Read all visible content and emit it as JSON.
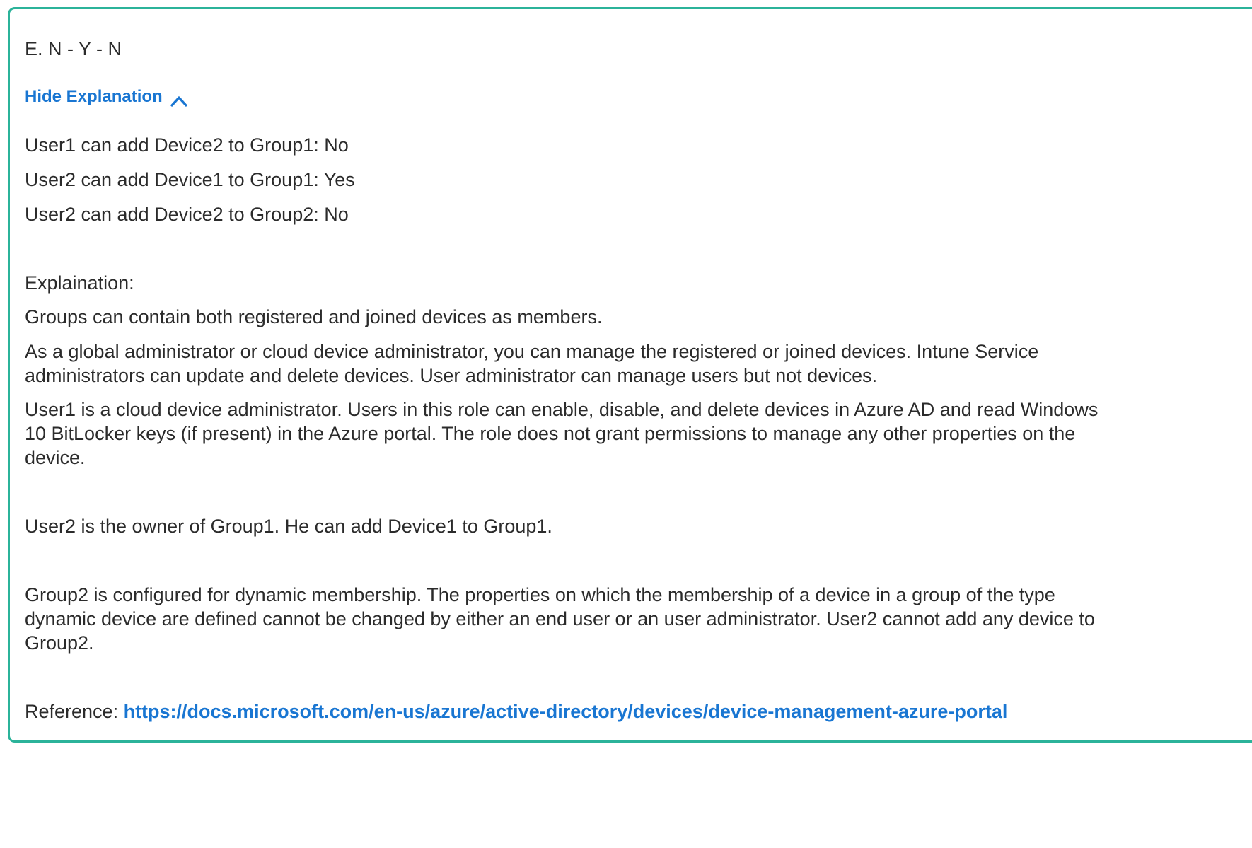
{
  "answer": "E. N - Y - N",
  "toggle": {
    "label": "Hide Explanation",
    "icon": "chevron-up-icon",
    "color": "#1976d2"
  },
  "results": [
    "User1 can add Device2 to Group1: No",
    "User2 can add Device1 to Group1: Yes",
    "User2 can add Device2 to Group2: No"
  ],
  "explanation": {
    "heading": "Explaination:",
    "paragraphs": [
      "Groups can contain both registered and joined devices as members.",
      "As a global administrator or cloud device administrator, you can manage the registered or joined devices. Intune Service administrators can update and delete devices. User administrator can manage users but not devices.",
      "User1 is a cloud device administrator. Users in this role can enable, disable, and delete devices in Azure AD and read Windows 10 BitLocker keys (if present) in the Azure portal. The role does not grant permissions to manage any other properties on the device.",
      "User2 is the owner of Group1. He can add Device1 to Group1.",
      "Group2 is configured for dynamic membership. The properties on which the membership of a device in a group of the type dynamic device are defined cannot be changed by either an end user or an user administrator. User2 cannot add any device to Group2."
    ]
  },
  "reference": {
    "label": "Reference: ",
    "url": "https://docs.microsoft.com/en-us/azure/active-directory/devices/device-management-azure-portal"
  },
  "colors": {
    "border": "#2bb39a",
    "link": "#1976d2",
    "text": "#2b2b2b"
  }
}
